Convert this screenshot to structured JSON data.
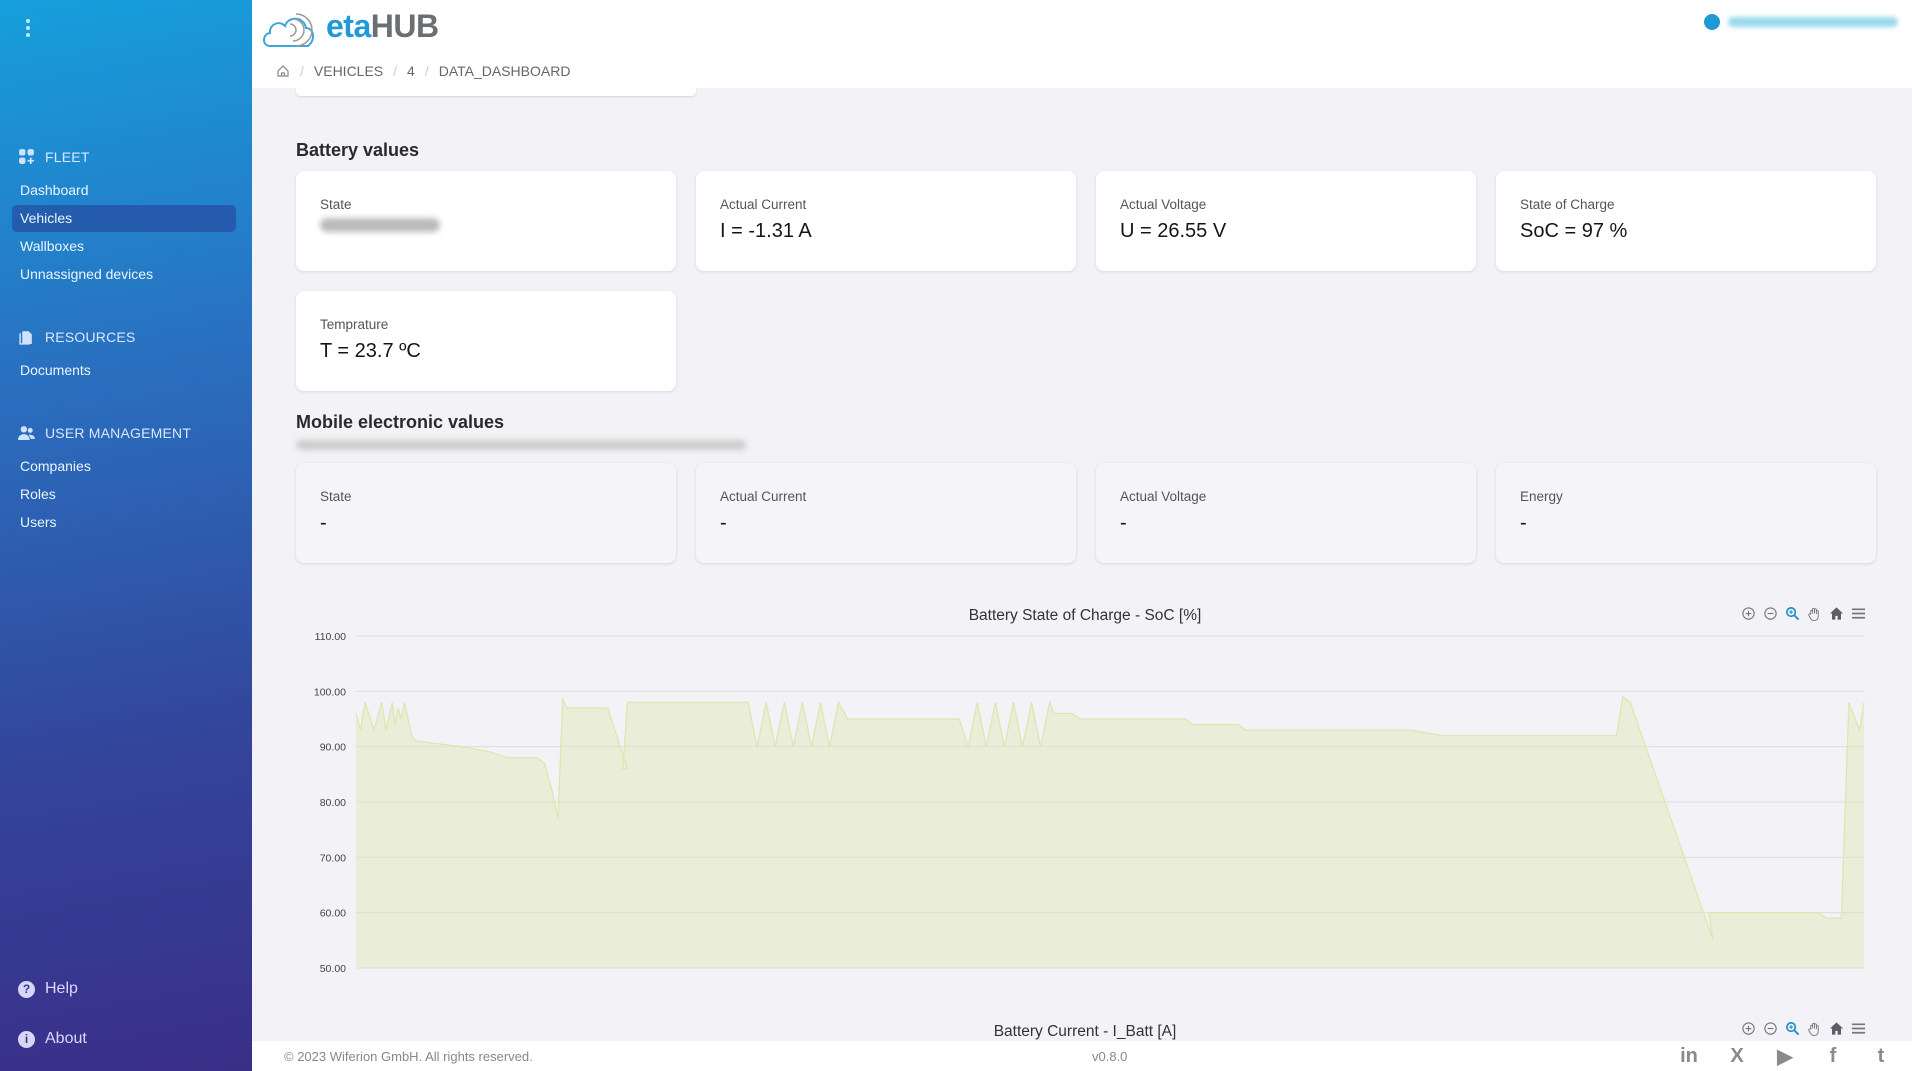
{
  "app": {
    "logo_eta": "eta",
    "logo_hub": "HUB"
  },
  "sidebar": {
    "sections": [
      {
        "title": "FLEET",
        "icon": "apps-add-icon",
        "items": [
          {
            "label": "Dashboard",
            "active": false
          },
          {
            "label": "Vehicles",
            "active": true
          },
          {
            "label": "Wallboxes",
            "active": false
          },
          {
            "label": "Unnassigned devices",
            "active": false
          }
        ]
      },
      {
        "title": "RESOURCES",
        "icon": "documents-icon",
        "items": [
          {
            "label": "Documents",
            "active": false
          }
        ]
      },
      {
        "title": "USER MANAGEMENT",
        "icon": "users-icon",
        "items": [
          {
            "label": "Companies",
            "active": false
          },
          {
            "label": "Roles",
            "active": false
          },
          {
            "label": "Users",
            "active": false
          }
        ]
      }
    ],
    "footer": [
      {
        "label": "Help",
        "icon": "help-icon",
        "glyph": "?"
      },
      {
        "label": "About",
        "icon": "info-icon",
        "glyph": "i"
      }
    ]
  },
  "breadcrumb": [
    "VEHICLES",
    "4",
    "DATA_DASHBOARD"
  ],
  "battery": {
    "title": "Battery values",
    "cards": [
      {
        "label": "State",
        "value": "",
        "blurred": true
      },
      {
        "label": "Actual Current",
        "value": "I = -1.31 A"
      },
      {
        "label": "Actual Voltage",
        "value": "U = 26.55 V"
      },
      {
        "label": "State of Charge",
        "value": "SoC = 97 %"
      },
      {
        "label": "Temprature",
        "value": "T = 23.7 ºC"
      }
    ]
  },
  "mobile": {
    "title": "Mobile electronic values",
    "cards": [
      {
        "label": "State",
        "value": "-"
      },
      {
        "label": "Actual Current",
        "value": "-"
      },
      {
        "label": "Actual Voltage",
        "value": "-"
      },
      {
        "label": "Energy",
        "value": "-"
      }
    ]
  },
  "chart_toolbar": [
    "zoom-in-icon",
    "zoom-out-icon",
    "selection-zoom-icon",
    "pan-icon",
    "reset-home-icon",
    "menu-icon"
  ],
  "chart_data": [
    {
      "type": "area",
      "title": "Battery State of Charge - SoC [%]",
      "xlabel": "",
      "ylabel": "",
      "ylim": [
        50,
        110
      ],
      "yticks": [
        "110.00",
        "100.00",
        "90.00",
        "80.00",
        "70.00",
        "60.00",
        "50.00"
      ],
      "grid": true,
      "color": "#dfe6b0",
      "x_fraction": [
        0,
        0.003,
        0.006,
        0.012,
        0.017,
        0.02,
        0.024,
        0.026,
        0.028,
        0.03,
        0.032,
        0.037,
        0.04,
        0.055,
        0.07,
        0.09,
        0.1,
        0.12,
        0.125,
        0.13,
        0.134,
        0.137,
        0.14,
        0.167,
        0.18,
        0.177,
        0.18,
        0.2,
        0.26,
        0.266,
        0.272,
        0.278,
        0.284,
        0.29,
        0.296,
        0.302,
        0.308,
        0.314,
        0.32,
        0.326,
        0.329,
        0.4,
        0.406,
        0.412,
        0.418,
        0.424,
        0.43,
        0.436,
        0.442,
        0.448,
        0.454,
        0.46,
        0.463,
        0.475,
        0.48,
        0.55,
        0.555,
        0.585,
        0.59,
        0.7,
        0.72,
        0.836,
        0.84,
        0.845,
        0.9,
        0.897,
        0.9,
        0.91,
        0.97,
        0.975,
        0.985,
        0.99,
        0.997,
        1.0
      ],
      "values": [
        96,
        93,
        98,
        93,
        98,
        93,
        98,
        94,
        97,
        95,
        98,
        92,
        91,
        90.5,
        90,
        89,
        88,
        88,
        87,
        82,
        77,
        98.5,
        97,
        97,
        86,
        86,
        98,
        98,
        98,
        90,
        98,
        90,
        98,
        90,
        98,
        90,
        98,
        90,
        98,
        95,
        95,
        95,
        90,
        98,
        90,
        98,
        90,
        98,
        90,
        98,
        90,
        98,
        96,
        96,
        95,
        95,
        94,
        94,
        93,
        93,
        92,
        92,
        99,
        98,
        55,
        60,
        60,
        60,
        60,
        59,
        59,
        98,
        93,
        98
      ]
    },
    {
      "type": "area",
      "title": "Battery Current - I_Batt [A]"
    }
  ],
  "footer": {
    "copyright": "© 2023 Wiferion GmbH. All rights reserved.",
    "version": "v0.8.0",
    "social": [
      {
        "name": "linkedin-icon",
        "glyph": "in"
      },
      {
        "name": "xing-icon",
        "glyph": "X"
      },
      {
        "name": "youtube-icon",
        "glyph": "▶"
      },
      {
        "name": "facebook-icon",
        "glyph": "f"
      },
      {
        "name": "twitter-icon",
        "glyph": "t"
      }
    ]
  }
}
